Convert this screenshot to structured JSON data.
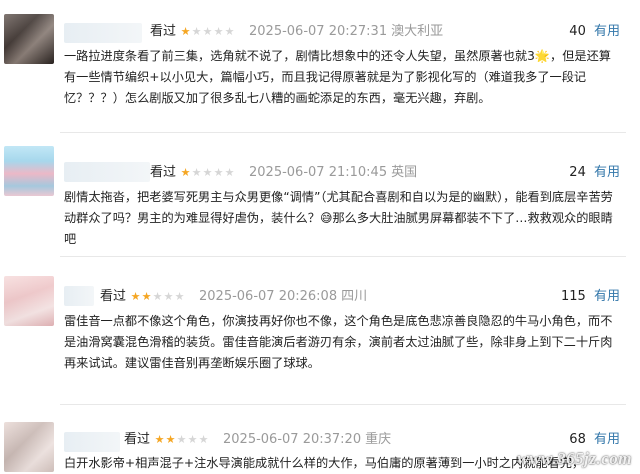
{
  "reviews": [
    {
      "status": "看过",
      "rating": 1,
      "max_rating": 5,
      "time": "2025-06-07 20:27:31",
      "location": "澳大利亚",
      "votes": "40",
      "vote_label": "有用",
      "text": "一路拉进度条看了前三集，选角就不说了，剧情比想象中的还令人失望，虽然原著也就3🌟，但是还算有一些情节编织+以小见大，篇幅小巧，而且我记得原著就是为了影视化写的（难道我多了一段记忆？？？）怎么剧版又加了很多乱七八糟的画蛇添足的东西，毫无兴趣，弃剧。"
    },
    {
      "status": "看过",
      "rating": 1,
      "max_rating": 5,
      "time": "2025-06-07 21:10:45",
      "location": "英国",
      "votes": "24",
      "vote_label": "有用",
      "text_before": "剧情太拖沓，把老婆写死男主与众男更像“调情”（尤其配合喜剧和自以为是的幽默），能看到底层辛苦劳动群众了吗？男主的为难显得好虐伪，装什么？",
      "emoji": "😅",
      "text_after": "那么多大肚油腻男屏幕都装不下了…救救观众的眼睛吧"
    },
    {
      "status": "看过",
      "rating": 2,
      "max_rating": 5,
      "time": "2025-06-07 20:26:08",
      "location": "四川",
      "votes": "115",
      "vote_label": "有用",
      "text": "雷佳音一点都不像这个角色，你演技再好你也不像，这个角色是底色悲凉善良隐忍的牛马小角色，而不是油滑窝囊混色滑稽的装货。雷佳音能演后者游刃有余，演前者太过油腻了些，除非身上到下二十斤肉再来试试。建议雷佳音别再垄断娱乐圈了球球。"
    },
    {
      "status": "看过",
      "rating": 2,
      "max_rating": 5,
      "time": "2025-06-07 20:37:20",
      "location": "重庆",
      "votes": "68",
      "vote_label": "有用",
      "text": "白开水影帝+相声混子+注水导演能成就什么样的大作，马伯庸的原著薄到一小时之内就能看完，"
    }
  ],
  "watermark": "www.365jz.com",
  "colors": {
    "star_on": "#f5a623",
    "star_off": "#d6d6d6",
    "link": "#3377aa",
    "meta_gray": "#9a9a9a"
  },
  "icons": [
    "star-icon"
  ]
}
